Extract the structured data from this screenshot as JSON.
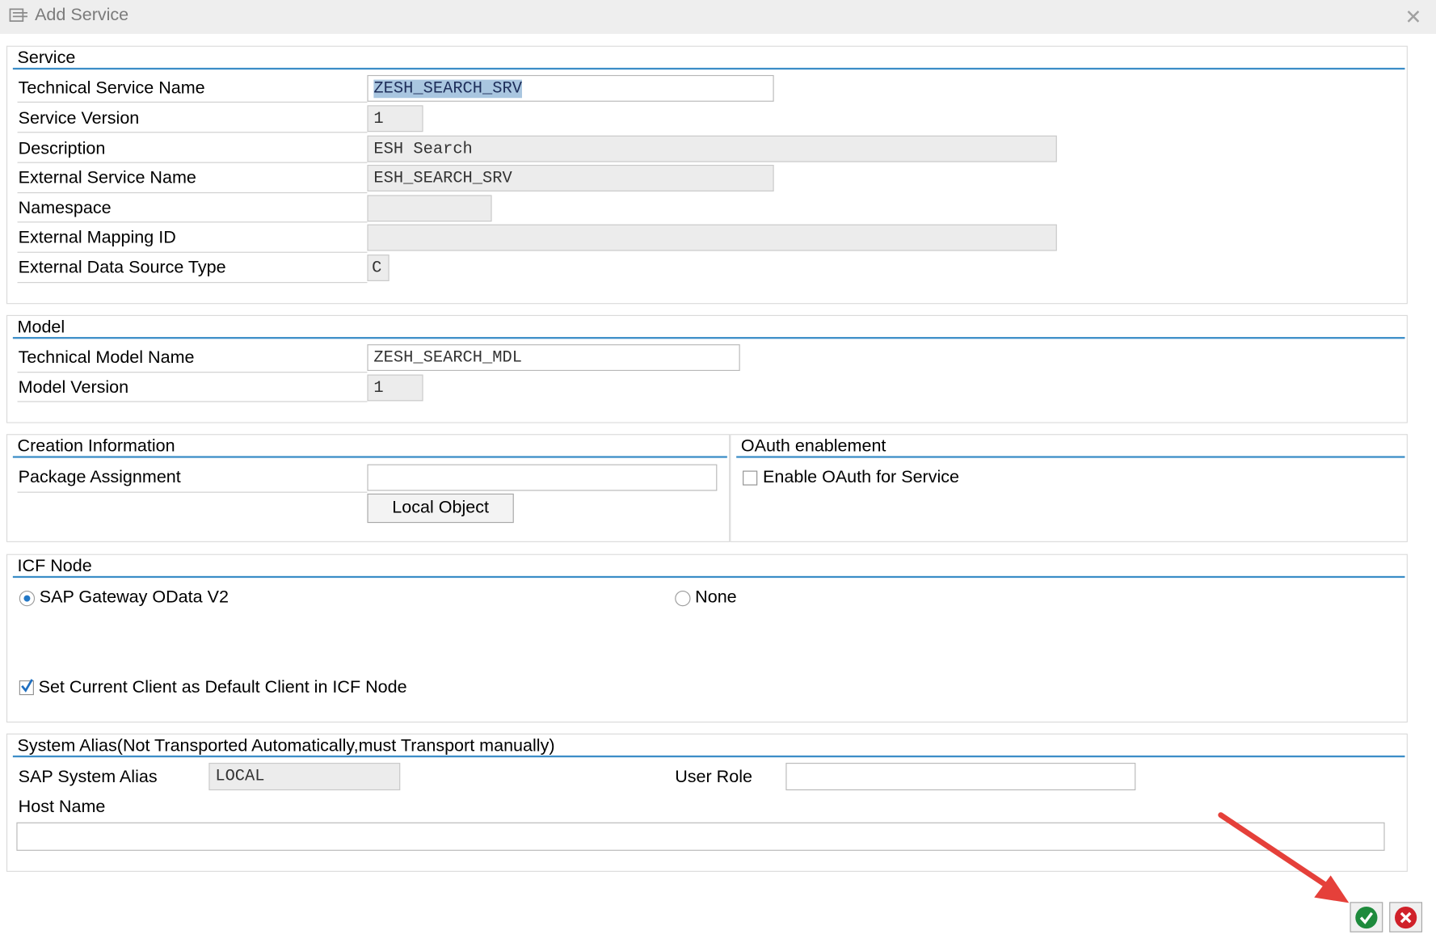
{
  "window": {
    "title": "Add Service"
  },
  "service": {
    "section_title": "Service",
    "technical_service_name": {
      "label": "Technical Service Name",
      "value": "ZESH_SEARCH_SRV"
    },
    "service_version": {
      "label": "Service Version",
      "value": "1"
    },
    "description": {
      "label": "Description",
      "value": "ESH Search"
    },
    "external_service_name": {
      "label": "External Service Name",
      "value": "ESH_SEARCH_SRV"
    },
    "namespace": {
      "label": "Namespace",
      "value": ""
    },
    "external_mapping_id": {
      "label": "External Mapping ID",
      "value": ""
    },
    "external_data_source_type": {
      "label": "External Data Source Type",
      "value": "C"
    }
  },
  "model": {
    "section_title": "Model",
    "technical_model_name": {
      "label": "Technical Model Name",
      "value": "ZESH_SEARCH_MDL"
    },
    "model_version": {
      "label": "Model Version",
      "value": "1"
    }
  },
  "creation": {
    "section_title": "Creation Information",
    "package_assignment": {
      "label": "Package Assignment",
      "value": ""
    },
    "local_object_button": "Local Object"
  },
  "oauth": {
    "section_title": "OAuth enablement",
    "enable_label": "Enable OAuth for Service",
    "enabled": false
  },
  "icf": {
    "section_title": "ICF Node",
    "option_gateway": "SAP Gateway OData V2",
    "option_none": "None",
    "selected": "SAP Gateway OData V2",
    "default_client_label": "Set Current Client as Default Client in ICF Node",
    "default_client_checked": true
  },
  "alias": {
    "section_title": "System Alias(Not Transported Automatically,must Transport manually)",
    "sap_system_alias": {
      "label": "SAP System Alias",
      "value": "LOCAL"
    },
    "user_role": {
      "label": "User Role",
      "value": ""
    },
    "host_name": {
      "label": "Host Name",
      "value": ""
    }
  },
  "colors": {
    "accent_rule": "#3b8dc7",
    "confirm": "#1e8a3c",
    "cancel": "#d0212a",
    "annotation_arrow": "#e5403a"
  },
  "icons": {
    "title": "dialog-icon",
    "close": "close-icon",
    "confirm": "check-icon",
    "cancel": "cancel-icon"
  }
}
